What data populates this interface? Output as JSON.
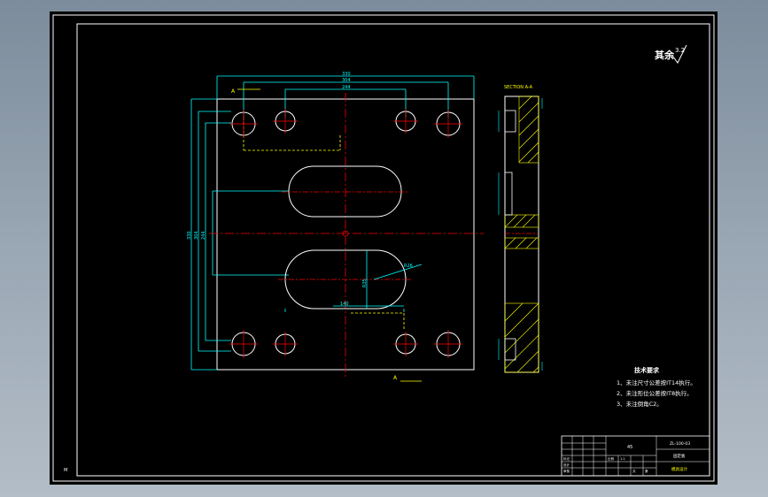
{
  "drawing": {
    "roughness_label": "其余",
    "roughness_value": "3.2",
    "section_title": "SECTION A-A",
    "section_mark_top": "A",
    "section_mark_bottom": "A",
    "dims": {
      "overall_width": "330",
      "bolt_spacing_outer": "304",
      "bolt_spacing_inner": "244",
      "height_left_a": "330",
      "height_left_b": "304",
      "height_left_c": "244",
      "slot_width": "140",
      "slot_height": "R35",
      "chamfer": "R26"
    },
    "tech_requirements": {
      "title": "技术要求",
      "items": [
        "1、未注尺寸公差按IT14执行。",
        "2、未注形位公差按IT8执行。",
        "3、未注倒角C2。"
      ]
    },
    "corner_mark": "M",
    "title_block": {
      "drawing_no": "ZL-100-03",
      "part_name": "固定板",
      "material": "45",
      "company": "模具设计",
      "cells": [
        "标记",
        "处数",
        "分区",
        "更改文件号",
        "签名",
        "日期",
        "设计",
        "审核",
        "工艺",
        "比例",
        "1:1",
        "共",
        "张",
        "第",
        "张"
      ]
    }
  },
  "colors": {
    "frame": "#ffffff",
    "outline": "#ffffff",
    "dim": "#00ffff",
    "center": "#ff0000",
    "hidden": "#ffff00",
    "hatch": "#ffff00",
    "note": "#ffffff"
  }
}
